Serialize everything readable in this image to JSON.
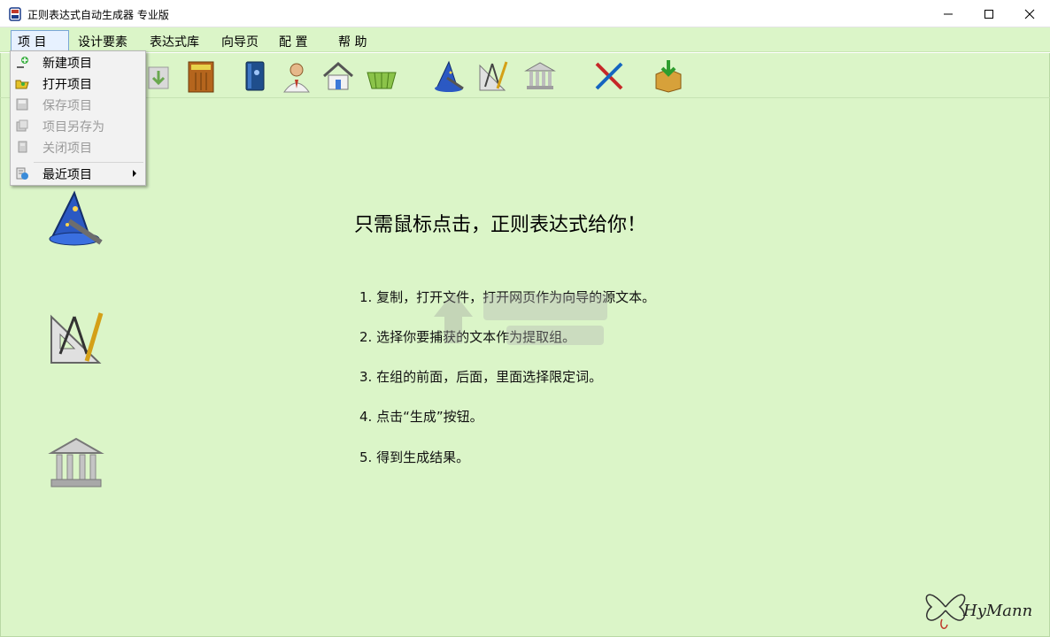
{
  "window": {
    "title": "正则表达式自动生成器 专业版",
    "controls": {
      "minimize": "minimize",
      "maximize": "maximize",
      "close": "close"
    }
  },
  "menubar": {
    "items": [
      {
        "label": "项  目",
        "active": true
      },
      {
        "label": "设计要素"
      },
      {
        "label": "表达式库"
      },
      {
        "label": "向导页"
      },
      {
        "label": "配  置"
      },
      {
        "label": "帮  助"
      }
    ]
  },
  "dropdown": {
    "items": [
      {
        "label": "新建项目",
        "enabled": true,
        "icon": "new-project-icon"
      },
      {
        "label": "打开项目",
        "enabled": true,
        "icon": "open-project-icon"
      },
      {
        "label": "保存项目",
        "enabled": false,
        "icon": "save-project-icon"
      },
      {
        "label": "项目另存为",
        "enabled": false,
        "icon": "save-as-icon"
      },
      {
        "label": "关闭项目",
        "enabled": false,
        "icon": "close-project-icon"
      },
      {
        "label": "最近项目",
        "enabled": true,
        "icon": "recent-projects-icon",
        "submenu": true
      }
    ]
  },
  "toolbar": {
    "icons": [
      "import-icon",
      "close-door-icon",
      "book-icon",
      "user-icon",
      "home-icon",
      "basket-icon",
      "wizard-icon",
      "drafting-tools-icon",
      "library-icon",
      "tools-icon",
      "download-box-icon"
    ]
  },
  "main": {
    "headline": "只需鼠标点击，正则表达式给你！",
    "steps": [
      "1. 复制，打开文件，打开网页作为向导的源文本。",
      "2. 选择你要捕获的文本作为提取组。",
      "3. 在组的前面，后面，里面选择限定词。",
      "4. 点击“生成”按钮。",
      "5. 得到生成结果。"
    ],
    "signature": "HyMann"
  },
  "colors": {
    "background": "#dbf5c8",
    "menu_highlight": "#e7f1ff",
    "disabled_text": "#9a9a9a"
  }
}
